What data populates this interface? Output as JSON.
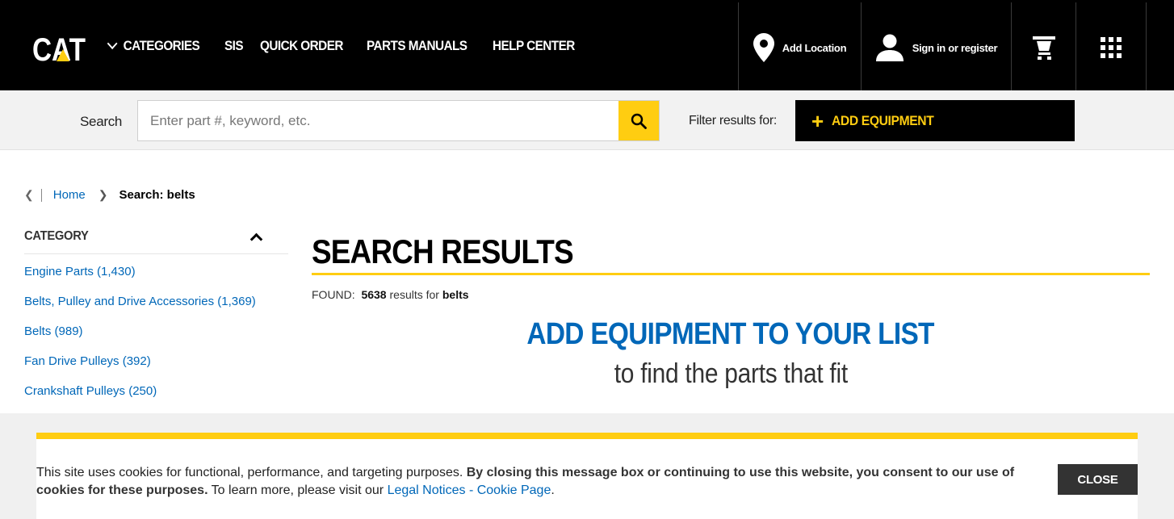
{
  "brand": {
    "logo_text": "CAT"
  },
  "nav": {
    "items": [
      {
        "label": "CATEGORIES",
        "has_dropdown": true
      },
      {
        "label": "SIS"
      },
      {
        "label": "QUICK ORDER"
      },
      {
        "label": "PARTS MANUALS"
      },
      {
        "label": "HELP CENTER"
      }
    ],
    "add_location": "Add Location",
    "sign_in": "Sign in or register",
    "icons": {
      "location": "location-pin-icon",
      "user": "user-icon",
      "cart": "cart-icon",
      "apps": "apps-grid-icon"
    }
  },
  "search": {
    "label": "Search",
    "placeholder": "Enter part #, keyword, etc.",
    "value": "",
    "filter_label": "Filter results for:",
    "add_equipment": "ADD EQUIPMENT"
  },
  "breadcrumb": {
    "home": "Home",
    "current": "Search: belts"
  },
  "sidebar": {
    "title": "CATEGORY",
    "items": [
      "Engine Parts (1,430)",
      "Belts, Pulley and Drive Accessories (1,369)",
      "Belts (989)",
      "Fan Drive Pulleys (392)",
      "Crankshaft Pulleys (250)"
    ]
  },
  "main": {
    "title": "SEARCH RESULTS",
    "found_prefix": "FOUND:",
    "found_count": "5638",
    "found_mid": "results for",
    "found_query": "belts",
    "promo_heading": "ADD EQUIPMENT TO YOUR LIST",
    "promo_sub": "to find the parts that fit"
  },
  "cookie": {
    "text_1": "This site uses cookies for functional, performance, and targeting purposes.",
    "text_bold": "By closing this message box or continuing to use this website, you consent to our use of cookies for these purposes.",
    "text_2": "To learn more, please visit our",
    "link": "Legal Notices - Cookie Page",
    "text_end": ".",
    "close": "CLOSE"
  },
  "colors": {
    "accent": "#ffcd11",
    "link": "#0067b8",
    "header": "#000000"
  }
}
